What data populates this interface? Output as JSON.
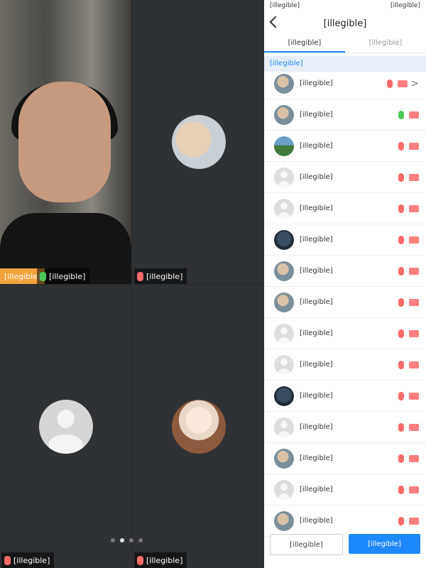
{
  "video": {
    "tiles": [
      {
        "name": "[illegible]",
        "host_badge": "[illegible]",
        "mic": "on"
      },
      {
        "name": "[illegible]",
        "mic": "off"
      },
      {
        "name": "[illegible]",
        "mic": "off"
      },
      {
        "name": "[illegible]",
        "mic": "off"
      }
    ],
    "pager": {
      "count": 4,
      "active_index": 1
    }
  },
  "panel": {
    "status_bar": {
      "left": "[illegible]",
      "right": "[illegible]"
    },
    "title": "[illegible]",
    "tabs": [
      {
        "label": "[illegible]"
      },
      {
        "label": "[illegible]"
      }
    ],
    "section_header": "[illegible]",
    "members": [
      {
        "name": "[illegible]",
        "mic": "off",
        "avatar": "photo",
        "chevron": ">"
      },
      {
        "name": "[illegible]",
        "mic": "on",
        "avatar": "photo"
      },
      {
        "name": "[illegible]",
        "mic": "off",
        "avatar": "land"
      },
      {
        "name": "[illegible]",
        "mic": "off",
        "avatar": "blank"
      },
      {
        "name": "[illegible]",
        "mic": "off",
        "avatar": "blank"
      },
      {
        "name": "[illegible]",
        "mic": "off",
        "avatar": "dark"
      },
      {
        "name": "[illegible]",
        "mic": "off",
        "avatar": "photo"
      },
      {
        "name": "[illegible]",
        "mic": "off",
        "avatar": "photo"
      },
      {
        "name": "[illegible]",
        "mic": "off",
        "avatar": "blank"
      },
      {
        "name": "[illegible]",
        "mic": "off",
        "avatar": "blank"
      },
      {
        "name": "[illegible]",
        "mic": "off",
        "avatar": "dark"
      },
      {
        "name": "[illegible]",
        "mic": "off",
        "avatar": "blank"
      },
      {
        "name": "[illegible]",
        "mic": "off",
        "avatar": "photo"
      },
      {
        "name": "[illegible]",
        "mic": "off",
        "avatar": "blank"
      },
      {
        "name": "[illegible]",
        "mic": "off",
        "avatar": "photo"
      }
    ],
    "footer": {
      "left_button": "[illegible]",
      "right_button": "[illegible]"
    }
  }
}
